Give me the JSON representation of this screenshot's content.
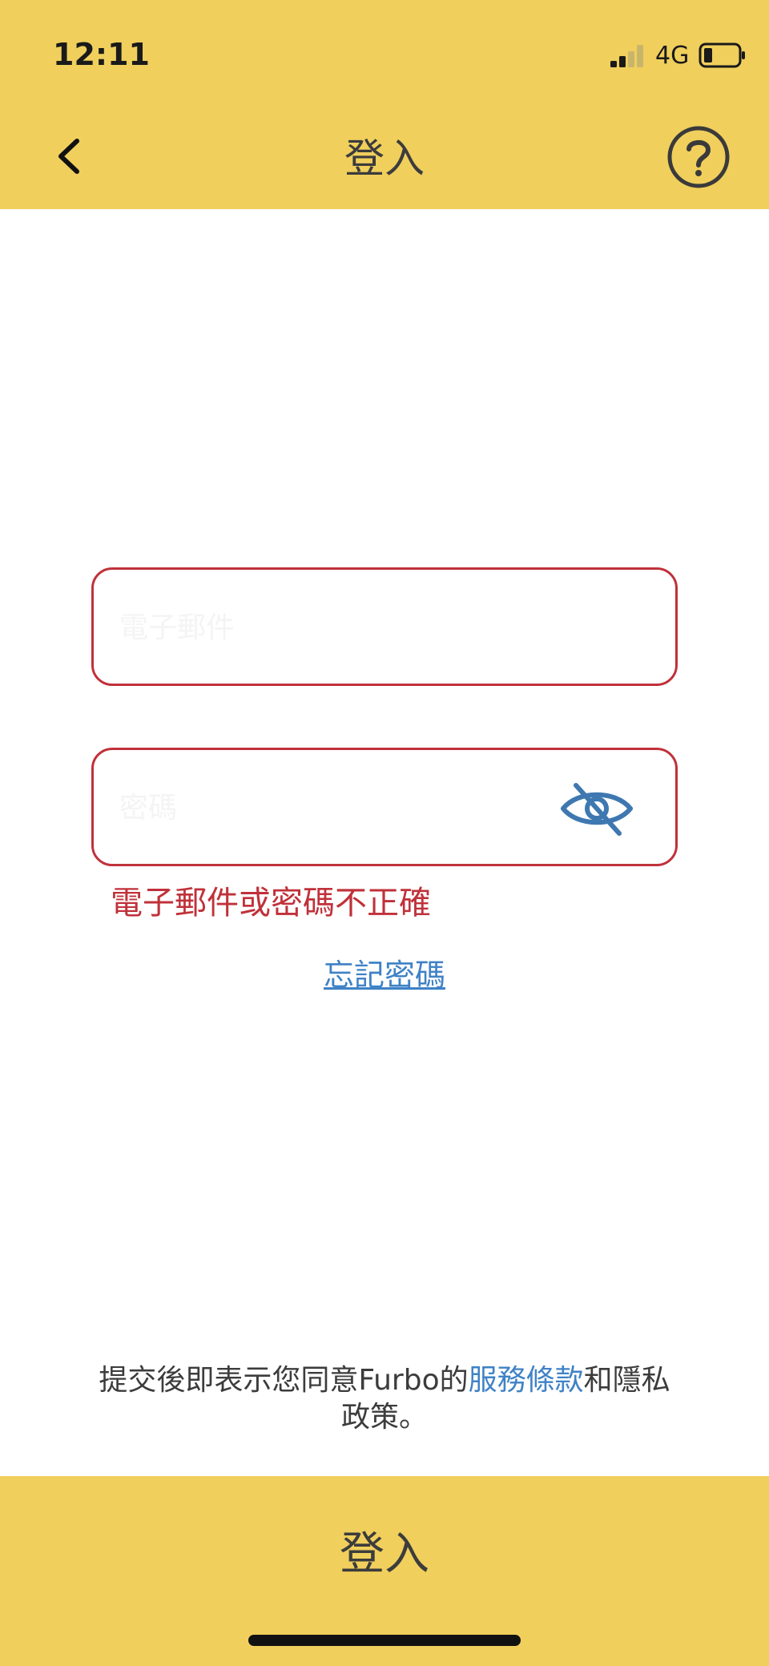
{
  "status_bar": {
    "time": "12:11",
    "network": "4G"
  },
  "header": {
    "title": "登入",
    "back_icon": "chevron-left-icon",
    "help_icon": "question-circle-icon"
  },
  "form": {
    "email": {
      "value": "",
      "placeholder": "電子郵件"
    },
    "password": {
      "value": "",
      "placeholder": "密碼",
      "toggle_icon": "eye-off-icon"
    },
    "error": "電子郵件或密碼不正確",
    "forgot_password": "忘記密碼"
  },
  "terms": {
    "prefix": "提交後即表示您同意Furbo的",
    "terms_link": "服務條款",
    "middle": "和",
    "privacy_link": "隱私政策",
    "suffix": "。"
  },
  "footer": {
    "login_label": "登入"
  },
  "colors": {
    "accent": "#F0CF5C",
    "error": "#C0313A",
    "link": "#3F82C6"
  }
}
